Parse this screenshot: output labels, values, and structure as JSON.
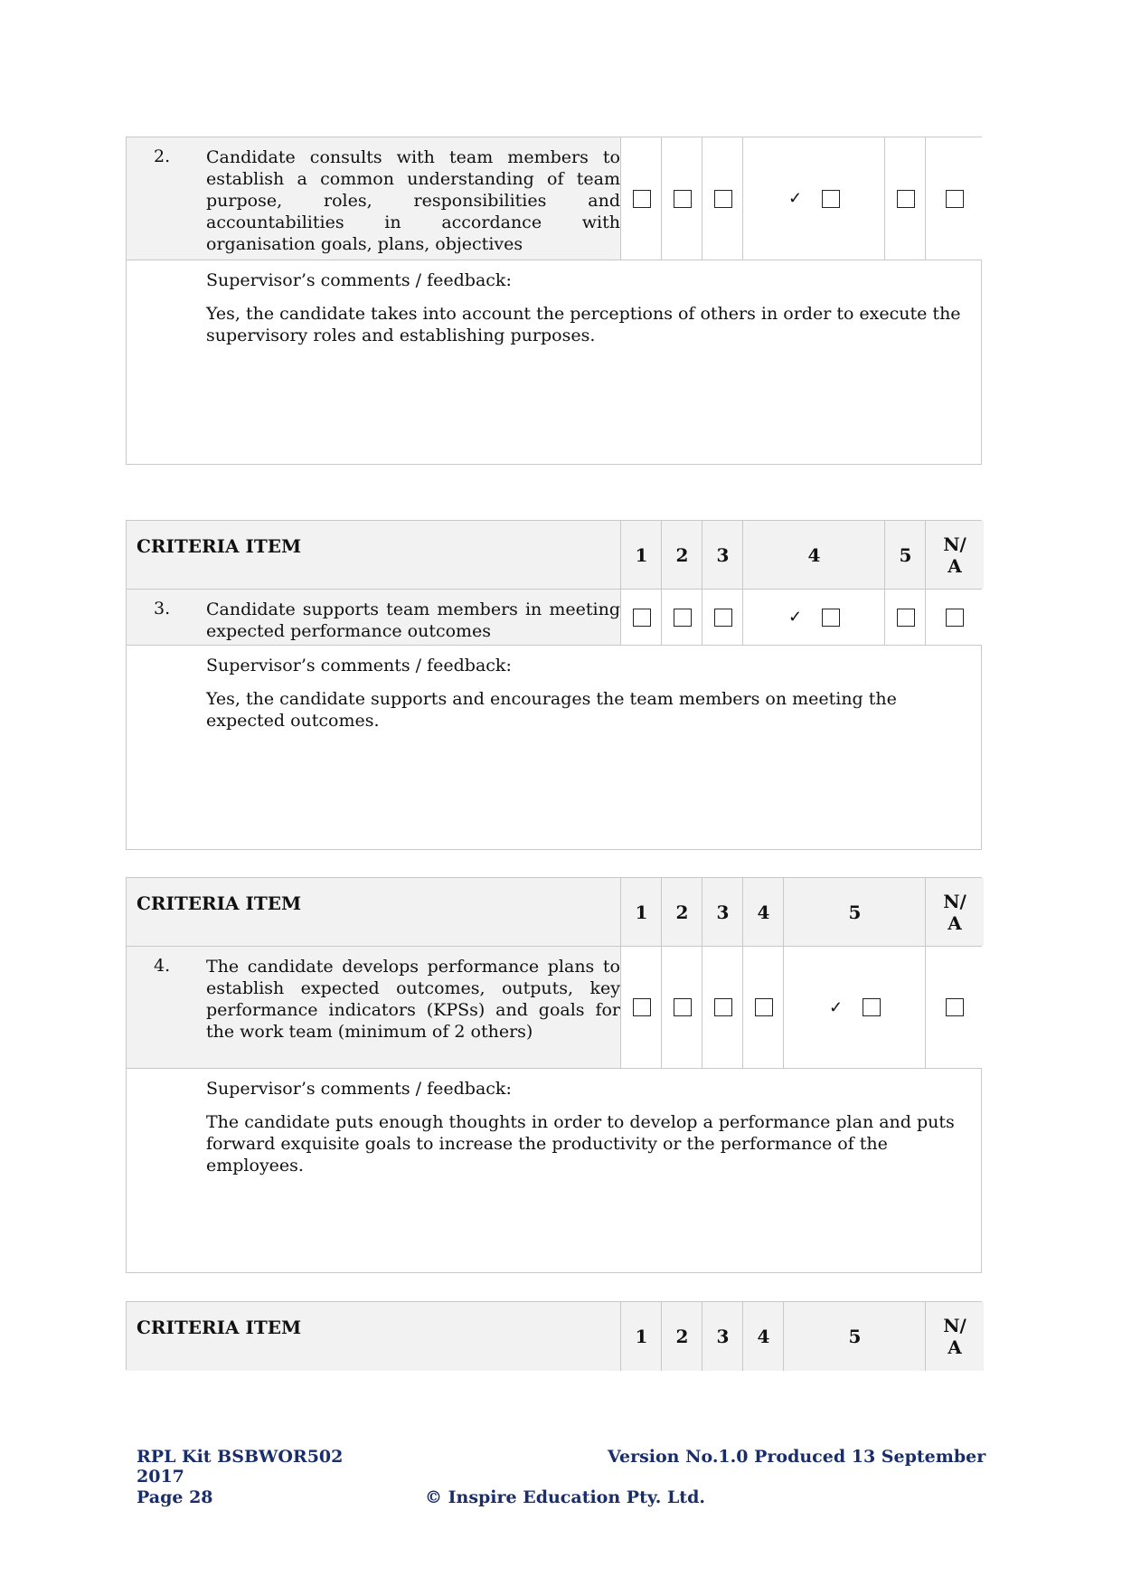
{
  "criteria_header": "CRITERIA ITEM",
  "scale": [
    "1",
    "2",
    "3",
    "4",
    "5",
    "N/\nA"
  ],
  "check_mark": "✓",
  "items": [
    {
      "number": "2.",
      "text": "Candidate consults with team members to establish a common understanding of team purpose, roles, responsibilities and accountabilities in accordance with organisation goals, plans, objectives",
      "rating": "4",
      "comment_label": "Supervisor’s comments / feedback:",
      "comment": "Yes, the candidate takes into account the perceptions of others in order to execute the supervisory roles and establishing purposes."
    },
    {
      "number": "3.",
      "text": "Candidate supports team members in meeting expected performance outcomes",
      "rating": "4",
      "comment_label": "Supervisor’s comments / feedback:",
      "comment": "Yes, the candidate supports and encourages the team members on meeting the expected outcomes."
    },
    {
      "number": "4.",
      "text": "The candidate develops performance plans to establish expected outcomes, outputs, key performance indicators (KPSs) and goals for the work team (minimum of 2 others)",
      "rating": "5",
      "comment_label": "Supervisor’s comments / feedback:",
      "comment": "The candidate puts enough thoughts in order to develop a performance plan and puts forward exquisite goals to increase the productivity or the performance of the employees."
    }
  ],
  "footer": {
    "left_line1": "RPL Kit BSBWOR502",
    "version": "Version No.1.0 Produced 13 September",
    "left_line2": "2017",
    "page": "Page 28",
    "copyright": "© Inspire Education Pty. Ltd."
  }
}
